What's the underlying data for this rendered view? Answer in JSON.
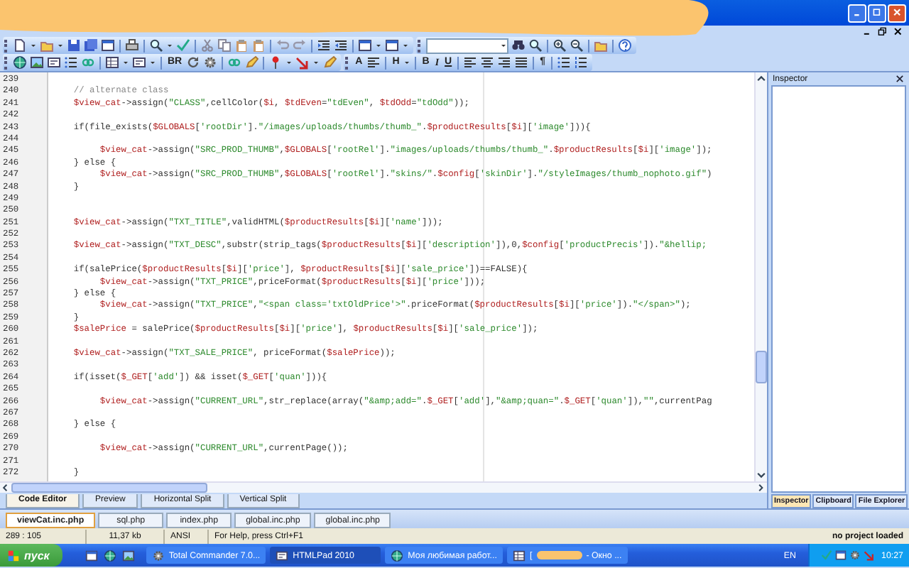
{
  "toolbar_2": {
    "text_buttons": [
      "BR",
      "A",
      "H",
      "B",
      "I",
      "U",
      "¶"
    ]
  },
  "editor": {
    "lines": [
      {
        "number": "239"
      },
      {
        "number": "240",
        "code": "    // alternate class"
      },
      {
        "number": "241",
        "code": "    $view_cat->assign(\"CLASS\",cellColor($i, $tdEven=\"tdEven\", $tdOdd=\"tdOdd\"));"
      },
      {
        "number": "242"
      },
      {
        "number": "243",
        "code": "    if(file_exists($GLOBALS['rootDir'].\"/images/uploads/thumbs/thumb_\".$productResults[$i]['image'])){"
      },
      {
        "number": "244"
      },
      {
        "number": "245",
        "code": "         $view_cat->assign(\"SRC_PROD_THUMB\",$GLOBALS['rootRel'].\"images/uploads/thumbs/thumb_\".$productResults[$i]['image']);"
      },
      {
        "number": "246",
        "code": "    } else {"
      },
      {
        "number": "247",
        "code": "         $view_cat->assign(\"SRC_PROD_THUMB\",$GLOBALS['rootRel'].\"skins/\".$config['skinDir'].\"/styleImages/thumb_nophoto.gif\")"
      },
      {
        "number": "248",
        "code": "    }"
      },
      {
        "number": "249"
      },
      {
        "number": "250"
      },
      {
        "number": "251",
        "code": "    $view_cat->assign(\"TXT_TITLE\",validHTML($productResults[$i]['name']));"
      },
      {
        "number": "252"
      },
      {
        "number": "253",
        "code": "    $view_cat->assign(\"TXT_DESC\",substr(strip_tags($productResults[$i]['description']),0,$config['productPrecis']).\"&hellip;"
      },
      {
        "number": "254"
      },
      {
        "number": "255",
        "code": "    if(salePrice($productResults[$i]['price'], $productResults[$i]['sale_price'])==FALSE){"
      },
      {
        "number": "256",
        "code": "         $view_cat->assign(\"TXT_PRICE\",priceFormat($productResults[$i]['price']));"
      },
      {
        "number": "257",
        "code": "    } else {"
      },
      {
        "number": "258",
        "code": "         $view_cat->assign(\"TXT_PRICE\",\"<span class='txtOldPrice'>\".priceFormat($productResults[$i]['price']).\"</span>\");"
      },
      {
        "number": "259",
        "code": "    }"
      },
      {
        "number": "260",
        "code": "    $salePrice = salePrice($productResults[$i]['price'], $productResults[$i]['sale_price']);"
      },
      {
        "number": "261"
      },
      {
        "number": "262",
        "code": "    $view_cat->assign(\"TXT_SALE_PRICE\", priceFormat($salePrice));"
      },
      {
        "number": "263"
      },
      {
        "number": "264",
        "code": "    if(isset($_GET['add']) && isset($_GET['quan'])){"
      },
      {
        "number": "265"
      },
      {
        "number": "266",
        "code": "         $view_cat->assign(\"CURRENT_URL\",str_replace(array(\"&amp;add=\".$_GET['add'],\"&amp;quan=\".$_GET['quan']),\"\",currentPag"
      },
      {
        "number": "267"
      },
      {
        "number": "268",
        "code": "    } else {"
      },
      {
        "number": "269"
      },
      {
        "number": "270",
        "code": "         $view_cat->assign(\"CURRENT_URL\",currentPage());"
      },
      {
        "number": "271"
      },
      {
        "number": "272",
        "code": "    }"
      }
    ]
  },
  "inspector": {
    "title": "Inspector"
  },
  "view_tabs": [
    {
      "label": "Code Editor",
      "selected": true
    },
    {
      "label": "Preview",
      "selected": false
    },
    {
      "label": "Horizontal Split",
      "selected": false
    },
    {
      "label": "Vertical Split",
      "selected": false
    }
  ],
  "panel_tabs": [
    {
      "label": "Inspector",
      "selected": true
    },
    {
      "label": "Clipboard",
      "selected": false
    },
    {
      "label": "File Explorer",
      "selected": false
    }
  ],
  "document_tabs": [
    {
      "label": "viewCat.inc.php",
      "selected": true
    },
    {
      "label": "sql.php",
      "selected": false
    },
    {
      "label": "index.php",
      "selected": false
    },
    {
      "label": "global.inc.php",
      "selected": false
    },
    {
      "label": "global.inc.php",
      "selected": false
    }
  ],
  "status_bar": {
    "position": "289 : 105",
    "size": "11,37 kb",
    "encoding": "ANSI",
    "hint": "For Help, press Ctrl+F1",
    "project": "no project loaded"
  },
  "taskbar": {
    "start": "пуск",
    "tasks": [
      {
        "kind": "plain",
        "label": "Total Commander 7.0...",
        "selected": false
      },
      {
        "kind": "plain",
        "label": "HTMLPad 2010",
        "selected": true
      },
      {
        "kind": "plain",
        "label": "Моя любимая работ...",
        "selected": false
      },
      {
        "kind": "redacted",
        "prefix": "[",
        "label": "- Окно ...",
        "selected": false
      }
    ],
    "language": "EN",
    "clock": "10:27"
  }
}
